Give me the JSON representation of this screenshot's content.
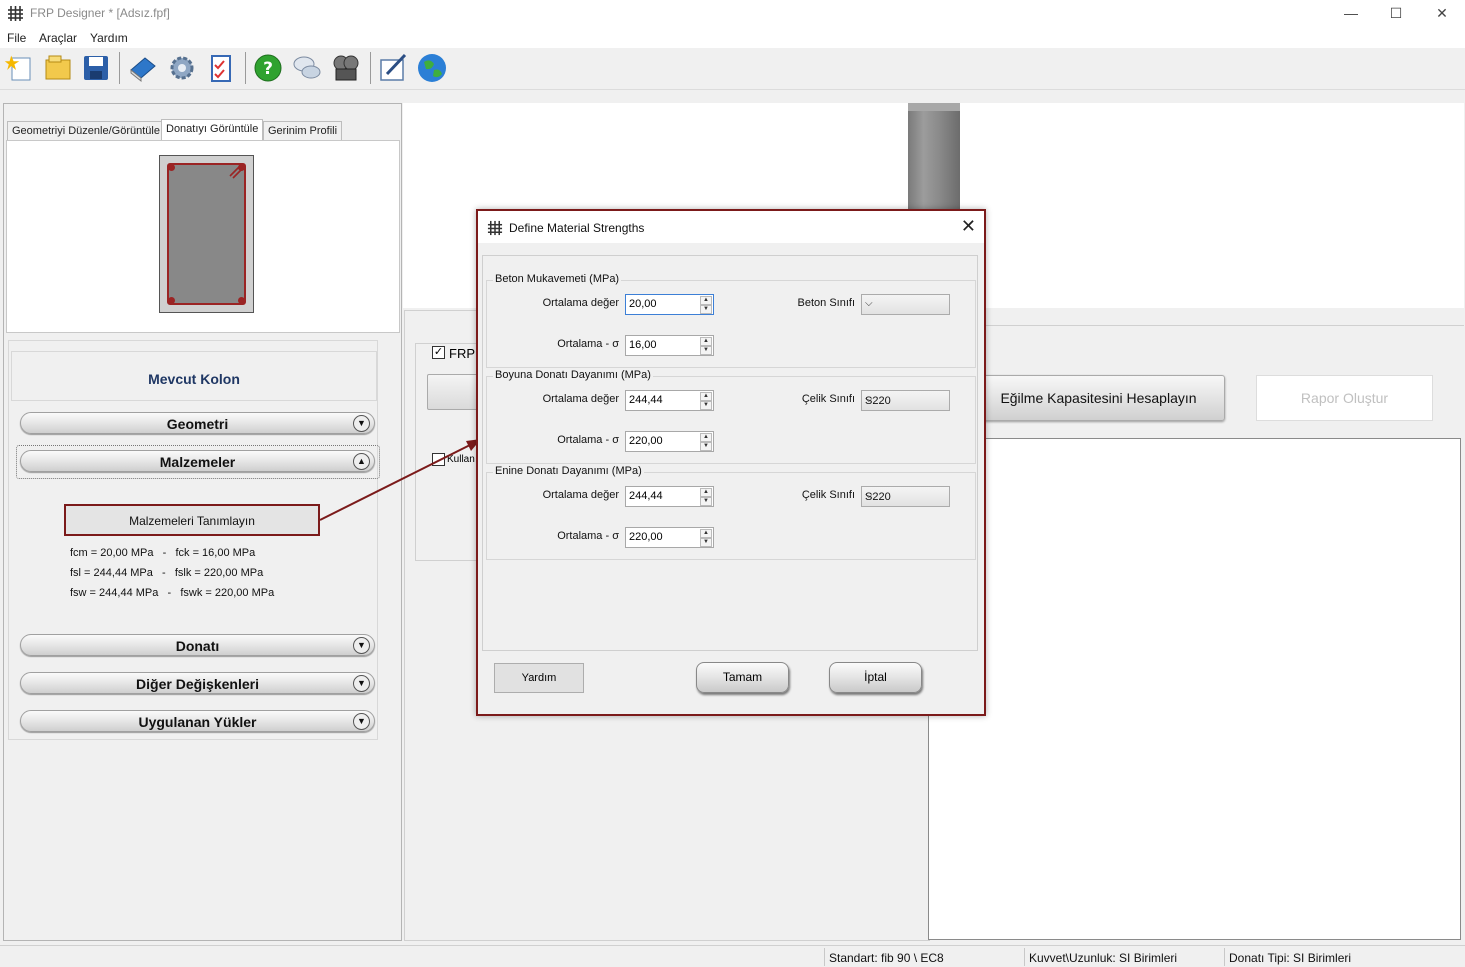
{
  "window": {
    "title": "FRP Designer * [Adsız.fpf]",
    "minimize": "—",
    "maximize": "☐",
    "close": "✕"
  },
  "menu": [
    "File",
    "Araçlar",
    "Yardım"
  ],
  "toolbar_icons": [
    "new-icon",
    "open-folder-icon",
    "save-icon",
    "book-icon",
    "settings-gear-icon",
    "checklist-icon",
    "help-icon",
    "chat-icon",
    "film-icon",
    "edit-note-icon",
    "globe-icon"
  ],
  "left": {
    "tabs": [
      "Geometriyi Düzenle/Görüntüle",
      "Donatıyı Görüntüle",
      "Gerinim Profili"
    ],
    "active_tab": 1,
    "section_title": "Mevcut Kolon",
    "accordion": [
      {
        "label": "Geometri",
        "state": "collapsed"
      },
      {
        "label": "Malzemeler",
        "state": "expanded"
      },
      {
        "label": "Donatı",
        "state": "collapsed"
      },
      {
        "label": "Diğer Değişkenleri",
        "state": "collapsed"
      },
      {
        "label": "Uygulanan Yükler",
        "state": "collapsed"
      }
    ],
    "materials_button": "Malzemeleri Tanımlayın",
    "materials_summary": [
      "fcm = 20,00 MPa   -   fck = 16,00 MPa",
      "fsl = 244,44 MPa   -   fslk = 220,00 MPa",
      "fsw = 244,44 MPa   -   fswk = 220,00 MPa"
    ]
  },
  "middle": {
    "frp_checkbox_label": "FRP",
    "frp_checked": true,
    "kullan_label": "Kullan",
    "kullan_checked": false
  },
  "right": {
    "calc_button": "Eğilme Kapasitesini Hesaplayın",
    "report_button": "Rapor Oluştur"
  },
  "status": {
    "standard": "Standart: fib 90 \\ EC8",
    "units": "Kuvvet\\Uzunluk: SI Birimleri",
    "rebar_type": "Donatı Tipi: SI Birimleri"
  },
  "dialog": {
    "title": "Define Material Strengths",
    "groups": [
      {
        "title": "Beton Mukavemeti (MPa)",
        "mean_label": "Ortalama değer",
        "mean_value": "20,00",
        "sigma_label": "Ortalama - σ",
        "sigma_value": "16,00",
        "class_label": "Beton Sınıfı",
        "class_value": ""
      },
      {
        "title": "Boyuna Donatı Dayanımı (MPa)",
        "mean_label": "Ortalama değer",
        "mean_value": "244,44",
        "sigma_label": "Ortalama - σ",
        "sigma_value": "220,00",
        "class_label": "Çelik Sınıfı",
        "class_value": "S220"
      },
      {
        "title": "Enine Donatı Dayanımı (MPa)",
        "mean_label": "Ortalama değer",
        "mean_value": "244,44",
        "sigma_label": "Ortalama - σ",
        "sigma_value": "220,00",
        "class_label": "Çelik Sınıfı",
        "class_value": "S220"
      }
    ],
    "help_button": "Yardım",
    "ok_button": "Tamam",
    "cancel_button": "İptal"
  },
  "colors": {
    "highlight": "#7b1a1a",
    "section_title": "#1f3764",
    "rebar": "#9b2424"
  }
}
